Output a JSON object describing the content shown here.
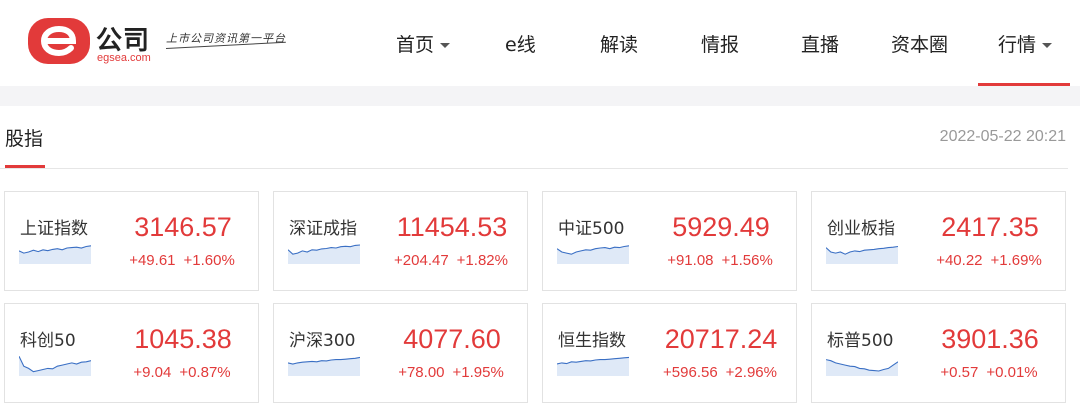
{
  "header": {
    "logo": {
      "brand": "公司",
      "url": "egsea.com",
      "slogan": "上市公司资讯第一平台"
    },
    "nav": [
      {
        "label": "首页",
        "dropdown": true
      },
      {
        "label": "e线",
        "dropdown": false
      },
      {
        "label": "解读",
        "dropdown": false
      },
      {
        "label": "情报",
        "dropdown": false
      },
      {
        "label": "直播",
        "dropdown": false
      },
      {
        "label": "资本圈",
        "dropdown": false
      },
      {
        "label": "行情",
        "dropdown": true,
        "active": true
      }
    ]
  },
  "section": {
    "title": "股指",
    "timestamp": "2022-05-22 20:21"
  },
  "colors": {
    "accent": "#e23a3a",
    "sparkline": "#3a6fc4"
  },
  "indices": [
    {
      "name": "上证指数",
      "price": "3146.57",
      "change": "+49.61",
      "pct": "+1.60%",
      "spark": [
        0.45,
        0.55,
        0.5,
        0.42,
        0.48,
        0.4,
        0.44,
        0.38,
        0.35,
        0.4,
        0.32,
        0.3,
        0.28,
        0.32,
        0.25,
        0.22
      ]
    },
    {
      "name": "深证成指",
      "price": "11454.53",
      "change": "+204.47",
      "pct": "+1.82%",
      "spark": [
        0.4,
        0.6,
        0.55,
        0.45,
        0.5,
        0.4,
        0.42,
        0.36,
        0.34,
        0.3,
        0.32,
        0.26,
        0.24,
        0.26,
        0.2,
        0.18
      ]
    },
    {
      "name": "中证500",
      "price": "5929.49",
      "change": "+91.08",
      "pct": "+1.56%",
      "spark": [
        0.35,
        0.5,
        0.55,
        0.6,
        0.5,
        0.45,
        0.4,
        0.42,
        0.35,
        0.32,
        0.3,
        0.35,
        0.28,
        0.3,
        0.25,
        0.22
      ]
    },
    {
      "name": "创业板指",
      "price": "2417.35",
      "change": "+40.22",
      "pct": "+1.69%",
      "spark": [
        0.3,
        0.5,
        0.55,
        0.5,
        0.6,
        0.5,
        0.45,
        0.48,
        0.42,
        0.4,
        0.38,
        0.35,
        0.33,
        0.3,
        0.28,
        0.25
      ]
    },
    {
      "name": "科创50",
      "price": "1045.38",
      "change": "+9.04",
      "pct": "+0.87%",
      "spark": [
        0.15,
        0.6,
        0.7,
        0.85,
        0.8,
        0.75,
        0.7,
        0.72,
        0.6,
        0.55,
        0.5,
        0.45,
        0.5,
        0.42,
        0.4,
        0.35
      ]
    },
    {
      "name": "沪深300",
      "price": "4077.60",
      "change": "+78.00",
      "pct": "+1.95%",
      "spark": [
        0.45,
        0.5,
        0.45,
        0.42,
        0.4,
        0.38,
        0.4,
        0.35,
        0.36,
        0.32,
        0.3,
        0.3,
        0.28,
        0.26,
        0.24,
        0.2
      ]
    },
    {
      "name": "恒生指数",
      "price": "20717.24",
      "change": "+596.56",
      "pct": "+2.96%",
      "spark": [
        0.5,
        0.45,
        0.48,
        0.4,
        0.42,
        0.38,
        0.35,
        0.36,
        0.32,
        0.3,
        0.3,
        0.28,
        0.26,
        0.24,
        0.22,
        0.2
      ]
    },
    {
      "name": "标普500",
      "price": "3901.36",
      "change": "+0.57",
      "pct": "+0.01%",
      "spark": [
        0.3,
        0.35,
        0.45,
        0.5,
        0.55,
        0.6,
        0.62,
        0.7,
        0.72,
        0.78,
        0.8,
        0.82,
        0.75,
        0.7,
        0.55,
        0.4
      ]
    }
  ]
}
